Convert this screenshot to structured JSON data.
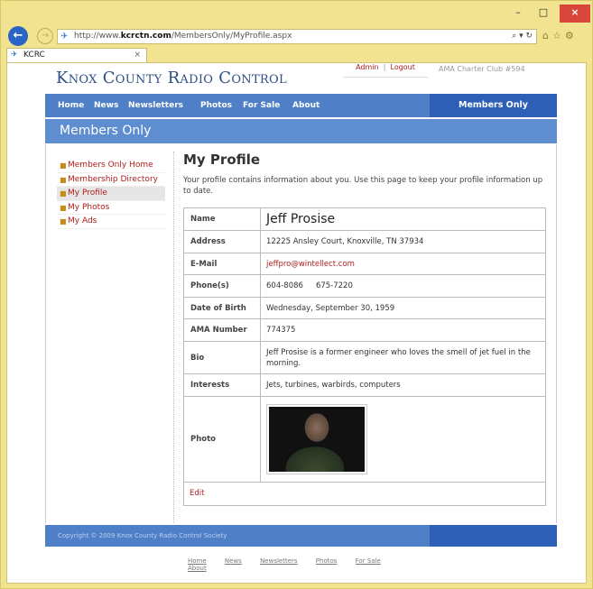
{
  "browser": {
    "window_controls": {
      "minimize": "–",
      "maximize": "□",
      "close": "×"
    },
    "url_prefix": "http://www.",
    "url_domain": "kcrctn.com",
    "url_path": "/MembersOnly/MyProfile.aspx",
    "address_tools": "⌕ ▾ ↻",
    "toolbar_icons": "⌂☆⚙",
    "back_glyph": "←",
    "forward_glyph": "→",
    "tab_title": "KCRC",
    "tab_close": "×",
    "favicon": "✈"
  },
  "site": {
    "title": "Knox County Radio Control",
    "admin_label": "Admin",
    "logout_label": "Logout",
    "separator": "|",
    "charter": "AMA Charter Club #594"
  },
  "topnav": {
    "items": [
      {
        "label": "Home"
      },
      {
        "label": "News"
      },
      {
        "label": "Newsletters"
      },
      {
        "label": "Photos"
      },
      {
        "label": "For Sale"
      },
      {
        "label": "About"
      }
    ],
    "members_label": "Members Only"
  },
  "banner": {
    "title": "Members Only"
  },
  "sidenav": {
    "bullet": "■",
    "items": [
      {
        "label": "Members Only Home"
      },
      {
        "label": "Membership Directory"
      },
      {
        "label": "My Profile"
      },
      {
        "label": "My Photos"
      },
      {
        "label": "My Ads"
      }
    ]
  },
  "profile": {
    "heading": "My Profile",
    "intro": "Your profile contains information about you. Use this page to keep your profile information up to date.",
    "rows": {
      "name": {
        "label": "Name",
        "value": "Jeff Prosise"
      },
      "address": {
        "label": "Address",
        "value": "12225 Ansley Court, Knoxville, TN 37934"
      },
      "email": {
        "label": "E-Mail",
        "value": "jeffpro@wintellect.com"
      },
      "phone": {
        "label": "Phone(s)",
        "value1": "604-8086",
        "value2": "675-7220"
      },
      "dob": {
        "label": "Date of Birth",
        "value": "Wednesday, September 30, 1959"
      },
      "ama": {
        "label": "AMA Number",
        "value": "774375"
      },
      "bio": {
        "label": "Bio",
        "value": "Jeff Prosise is a former engineer who loves the smell of jet fuel in the morning."
      },
      "interests": {
        "label": "Interests",
        "value": "Jets, turbines, warbirds, computers"
      },
      "photo": {
        "label": "Photo"
      }
    },
    "edit_label": "Edit"
  },
  "footer": {
    "copyright": "Copyright © 2009 Knox County Radio Control Society",
    "links": [
      {
        "label": "Home"
      },
      {
        "label": "News"
      },
      {
        "label": "Newsletters"
      },
      {
        "label": "Photos"
      },
      {
        "label": "For Sale"
      },
      {
        "label": "About"
      }
    ]
  }
}
